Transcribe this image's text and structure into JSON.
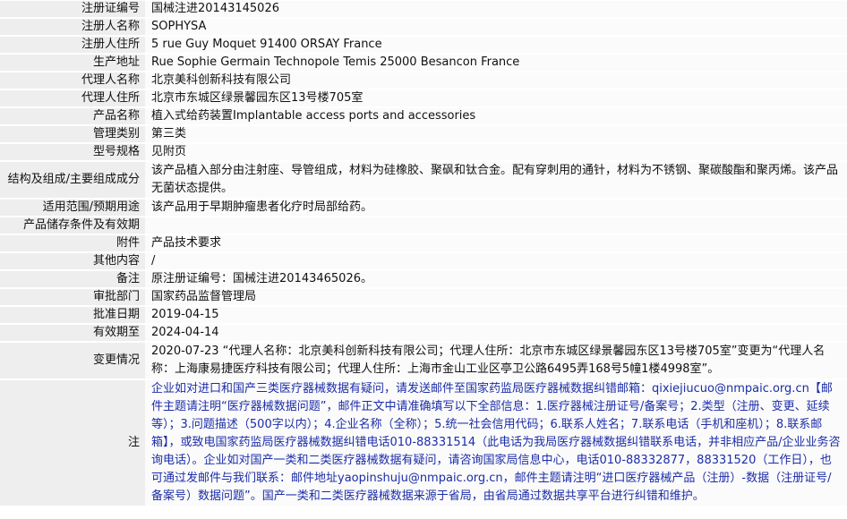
{
  "rows": [
    {
      "label": "注册证编号",
      "value": "国械注进20143145026"
    },
    {
      "label": "注册人名称",
      "value": "SOPHYSA"
    },
    {
      "label": "注册人住所",
      "value": "5 rue Guy Moquet 91400 ORSAY France"
    },
    {
      "label": "生产地址",
      "value": "Rue Sophie Germain Technopole Temis 25000 Besancon France"
    },
    {
      "label": "代理人名称",
      "value": "北京美科创新科技有限公司"
    },
    {
      "label": "代理人住所",
      "value": "北京市东城区绿景馨园东区13号楼705室"
    },
    {
      "label": "产品名称",
      "value": "植入式给药装置Implantable access ports and accessories"
    },
    {
      "label": "管理类别",
      "value": "第三类"
    },
    {
      "label": "型号规格",
      "value": "见附页"
    },
    {
      "label": "结构及组成/主要组成成分",
      "value": "该产品植入部分由注射座、导管组成，材料为硅橡胶、聚砜和钛合金。配有穿刺用的通针，材料为不锈钢、聚碳酸酯和聚丙烯。该产品无菌状态提供。"
    },
    {
      "label": "适用范围/预期用途",
      "value": "该产品用于早期肿瘤患者化疗时局部给药。"
    },
    {
      "label": "产品储存条件及有效期",
      "value": ""
    },
    {
      "label": "附件",
      "value": "产品技术要求"
    },
    {
      "label": "其他内容",
      "value": "/"
    },
    {
      "label": "备注",
      "value": "原注册证编号：国械注进20143465026。"
    },
    {
      "label": "审批部门",
      "value": "国家药品监督管理局"
    },
    {
      "label": "批准日期",
      "value": "2019-04-15"
    },
    {
      "label": "有效期至",
      "value": "2024-04-14"
    },
    {
      "label": "变更情况",
      "value": "2020-07-23 “代理人名称：北京美科创新科技有限公司；代理人住所：北京市东城区绿景馨园东区13号楼705室”变更为“代理人名称：上海康易捷医疗科技有限公司；代理人住所：上海市金山工业区亭卫公路6495弄168号5幢1楼4998室”。"
    }
  ],
  "note": {
    "label": "注",
    "value": "企业如对进口和国产三类医疗器械数据有疑问，请发送邮件至国家药监局医疗器械数据纠错邮箱：qixiejiucuo@nmpaic.org.cn【邮件主题请注明“医疗器械数据问题”，邮件正文中请准确填写以下全部信息：1.医疗器械注册证号/备案号；2.类型（注册、变更、延续等）；3.问题描述（500字以内）；4.企业名称（全称）；5.统一社会信用代码；6.联系人姓名；7.联系电话（手机和座机）；8.联系邮箱】，或致电国家药监局医疗器械数据纠错电话010-88331514（此电话为我局医疗器械数据纠错联系电话，并非相应产品/企业业务咨询电话）。企业如对国产一类和二类医疗器械数据有疑问，请咨询国家局信息中心，电话010-88332877，88331520（工作日），也可通过发邮件与我们联系：邮件地址yaopinshuju@nmpaic.org.cn，邮件主题请注明“进口医疗器械产品（注册）-数据（注册证号/备案号）数据问题”。国产一类和二类医疗器械数据来源于省局，由省局通过数据共享平台进行纠错和维护。"
  }
}
